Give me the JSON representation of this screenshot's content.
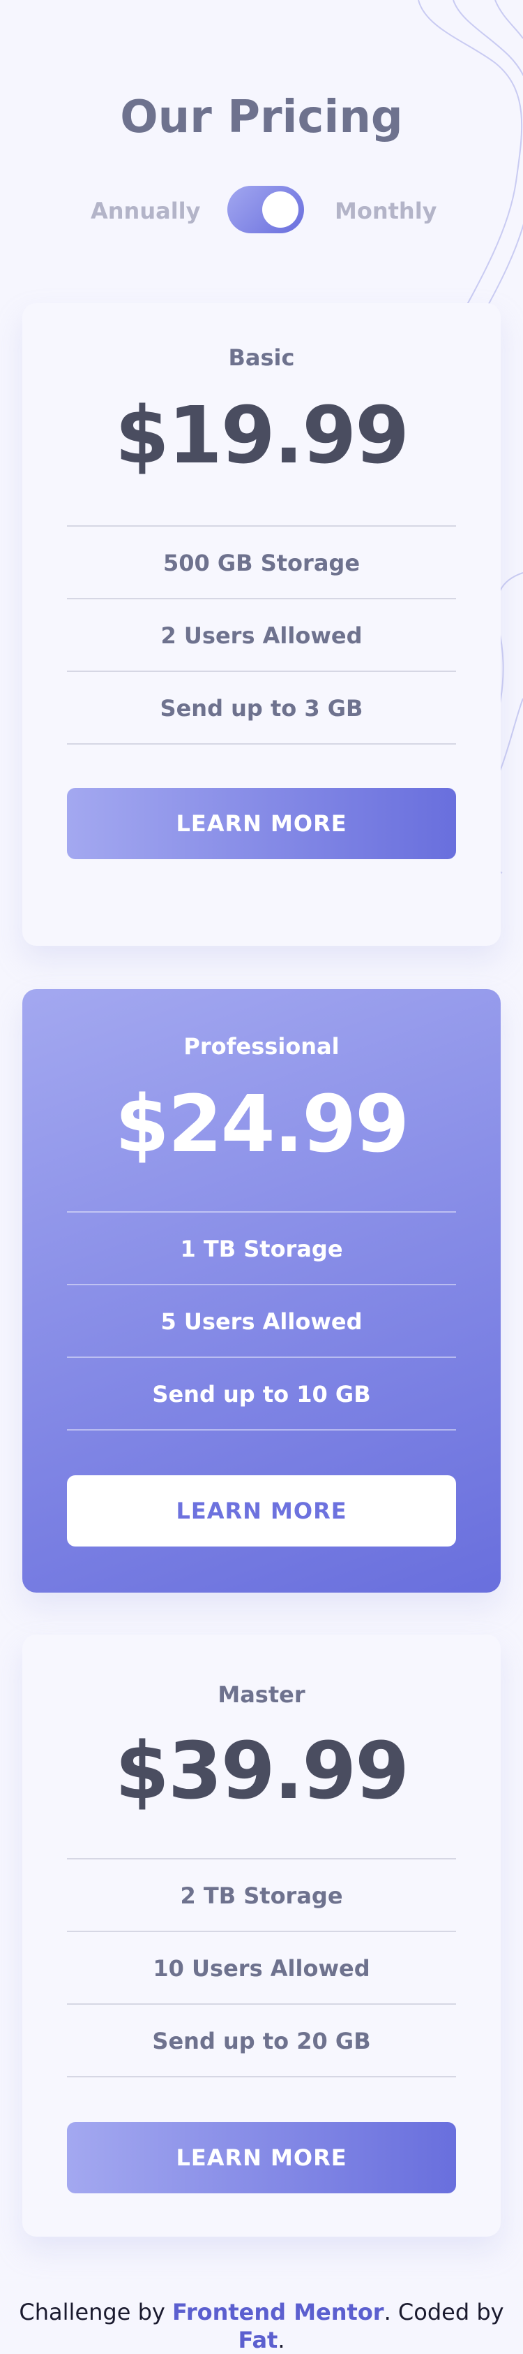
{
  "header": {
    "title": "Our Pricing",
    "toggle": {
      "left_label": "Annually",
      "right_label": "Monthly",
      "selected": "Monthly"
    }
  },
  "colors": {
    "background": "#f6f6fe",
    "accent_start": "#a3a8f0",
    "accent_end": "#696fdd",
    "heading": "#6e728e",
    "price": "#4a4d60"
  },
  "plans": [
    {
      "name": "Basic",
      "price": "$19.99",
      "features": [
        "500 GB Storage",
        "2 Users Allowed",
        "Send up to 3 GB"
      ],
      "button_label": "LEARN MORE"
    },
    {
      "name": "Professional",
      "price": "$24.99",
      "features": [
        "1 TB Storage",
        "5 Users Allowed",
        "Send up to 10 GB"
      ],
      "button_label": "LEARN MORE"
    },
    {
      "name": "Master",
      "price": "$39.99",
      "features": [
        "2 TB Storage",
        "10 Users Allowed",
        "Send up to 20 GB"
      ],
      "button_label": "LEARN MORE"
    }
  ],
  "footer": {
    "prefix": "Challenge by ",
    "link1": "Frontend Mentor",
    "middle": ". Coded by ",
    "link2": "Fat",
    "suffix": "."
  }
}
